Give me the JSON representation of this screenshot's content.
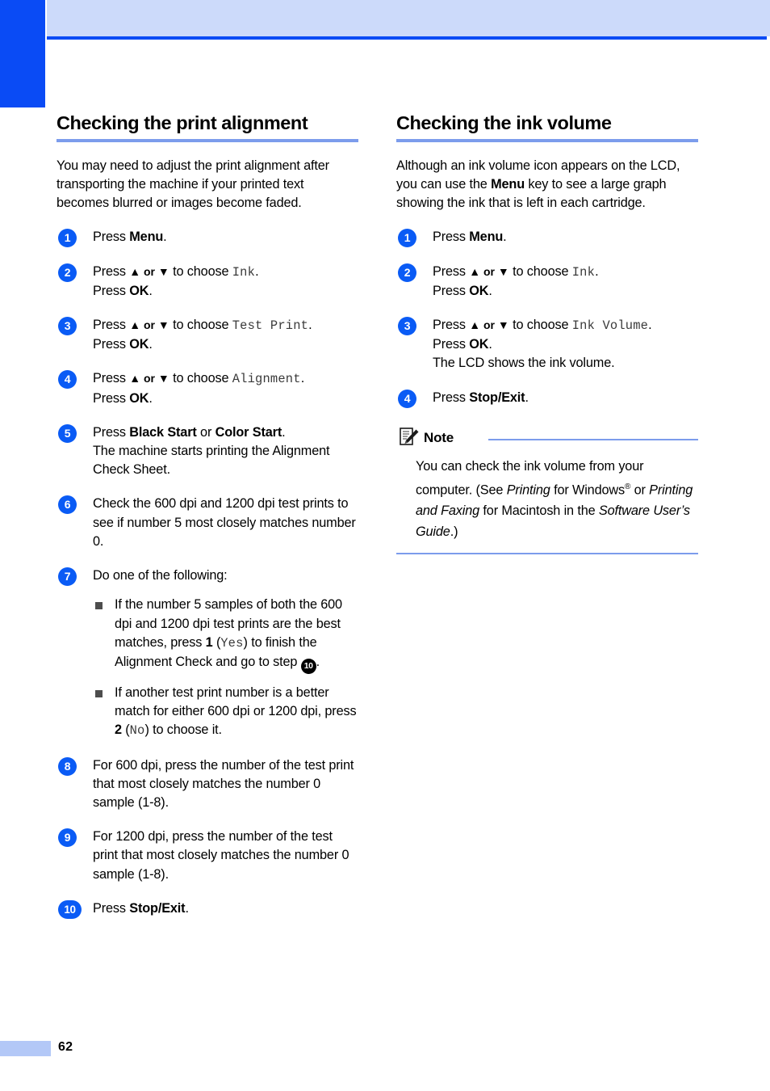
{
  "page": {
    "number": "62",
    "accent_blue": "#0A4BF5",
    "band_blue": "#CCDAFA",
    "rule_blue": "#7C9CEC",
    "badge_blue": "#0A5BF5"
  },
  "left_column": {
    "title": "Checking the print alignment",
    "intro": "You may need to adjust the print alignment after transporting the machine if your printed text becomes blurred or images become faded.",
    "steps": [
      {
        "num": "1",
        "line1_pre": "Press ",
        "line1_key": "Menu",
        "line1_post": "."
      },
      {
        "num": "2",
        "line1_pre": "Press ",
        "arrows": "▲ or ▼",
        "line1_mid": " to choose ",
        "lcd": "Ink",
        "line1_post": ".",
        "line2_pre": "Press ",
        "line2_key": "OK",
        "line2_post": "."
      },
      {
        "num": "3",
        "line1_pre": "Press ",
        "arrows": "▲ or ▼",
        "line1_mid": " to choose ",
        "lcd": "Test Print",
        "line1_post": ".",
        "line2_pre": "Press ",
        "line2_key": "OK",
        "line2_post": "."
      },
      {
        "num": "4",
        "line1_pre": "Press ",
        "arrows": "▲ or ▼",
        "line1_mid": " to choose ",
        "lcd": "Alignment",
        "line1_post": ".",
        "line2_pre": "Press ",
        "line2_key": "OK",
        "line2_post": "."
      },
      {
        "num": "5",
        "line1_pre": "Press ",
        "key_a": "Black Start",
        "line1_mid": " or ",
        "key_b": "Color Start",
        "line1_post": ".",
        "line2": "The machine starts printing the Alignment Check Sheet."
      },
      {
        "num": "6",
        "body": "Check the 600 dpi and 1200 dpi test prints to see if number 5 most closely matches number 0."
      },
      {
        "num": "7",
        "body": "Do one of the following:",
        "bullets": [
          {
            "part1": "If the number 5 samples of both the 600 dpi and 1200 dpi test prints are the best matches, press ",
            "key": "1",
            "part2": " (",
            "lcd": "Yes",
            "part3": ") to finish the Alignment Check and go to step ",
            "ref": "10",
            "part4": "."
          },
          {
            "part1": "If another test print number is a better match for either 600 dpi or 1200 dpi, press ",
            "key": "2",
            "part2": " (",
            "lcd": "No",
            "part3": ") to choose it.",
            "ref": "",
            "part4": ""
          }
        ]
      },
      {
        "num": "8",
        "body": "For 600 dpi, press the number of the test print that most closely matches the number 0 sample (1-8)."
      },
      {
        "num": "9",
        "body": "For 1200 dpi, press the number of the test print that most closely matches the number 0 sample (1-8)."
      },
      {
        "num": "10",
        "line1_pre": "Press ",
        "line1_key": "Stop/Exit",
        "line1_post": "."
      }
    ]
  },
  "right_column": {
    "title": "Checking the ink volume",
    "intro_pre": "Although an ink volume icon appears on the LCD, you can use the ",
    "intro_key": "Menu",
    "intro_post": " key to see a large graph showing the ink that is left in each cartridge.",
    "steps": [
      {
        "num": "1",
        "line1_pre": "Press ",
        "line1_key": "Menu",
        "line1_post": "."
      },
      {
        "num": "2",
        "line1_pre": "Press ",
        "arrows": "▲ or ▼",
        "line1_mid": " to choose ",
        "lcd": "Ink",
        "line1_post": ".",
        "line2_pre": "Press ",
        "line2_key": "OK",
        "line2_post": "."
      },
      {
        "num": "3",
        "line1_pre": "Press ",
        "arrows": "▲ or ▼",
        "line1_mid": " to choose ",
        "lcd": "Ink Volume",
        "line1_post": ".",
        "line2_pre": "Press ",
        "line2_key": "OK",
        "line2_post": ".",
        "line3": "The LCD shows the ink volume."
      },
      {
        "num": "4",
        "line1_pre": "Press ",
        "line1_key": "Stop/Exit",
        "line1_post": "."
      }
    ],
    "note": {
      "label": "Note",
      "part1": "You can check the ink volume from your computer. (See ",
      "ital1": "Printing",
      "part2": " for Windows",
      "reg": "®",
      "part3": " or ",
      "ital2": "Printing and Faxing",
      "part4": " for Macintosh in the ",
      "ital3": "Software User’s Guide",
      "part5": ".)"
    }
  }
}
